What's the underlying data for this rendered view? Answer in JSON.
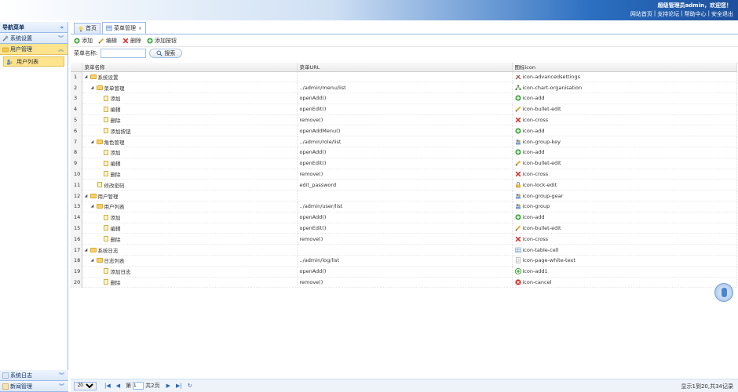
{
  "header": {
    "welcome": "超级管理员admin，欢迎您！",
    "links": [
      "网站首页",
      "支持论坛",
      "帮助中心",
      "安全退出"
    ]
  },
  "sidebar": {
    "title": "导航菜单",
    "items": [
      {
        "label": "系统设置",
        "active": false
      },
      {
        "label": "用户管理",
        "active": true
      }
    ],
    "subitem": "用户列表",
    "bottom": [
      {
        "label": "系统日志"
      },
      {
        "label": "新闻管理"
      }
    ]
  },
  "tabs": [
    {
      "label": "首页",
      "closable": false
    },
    {
      "label": "菜单管理",
      "closable": true
    }
  ],
  "toolbar": {
    "add": "添加",
    "edit": "编辑",
    "delete": "删除",
    "add_button": "添加按钮"
  },
  "search": {
    "label": "菜单名称:",
    "button": "搜索",
    "value": ""
  },
  "grid": {
    "columns": [
      "菜单名称",
      "菜单URL",
      "图标icon"
    ],
    "rows": [
      {
        "n": "1",
        "level": 0,
        "type": "folder",
        "arrow": "◢",
        "name": "系统设置",
        "url": "",
        "icon": "icon-advancedsettings",
        "ic": "advanced"
      },
      {
        "n": "2",
        "level": 1,
        "type": "folder",
        "arrow": "◢",
        "name": "菜单管理",
        "url": "../admin/menu/list",
        "icon": "icon-chart-organisation",
        "ic": "org"
      },
      {
        "n": "3",
        "level": 2,
        "type": "file",
        "arrow": "",
        "name": "添加",
        "url": "openAdd()",
        "icon": "icon-add",
        "ic": "add"
      },
      {
        "n": "4",
        "level": 2,
        "type": "file",
        "arrow": "",
        "name": "编辑",
        "url": "openEdit()",
        "icon": "icon-bullet-edit",
        "ic": "edit"
      },
      {
        "n": "5",
        "level": 2,
        "type": "file",
        "arrow": "",
        "name": "删除",
        "url": "remove()",
        "icon": "icon-cross",
        "ic": "cross"
      },
      {
        "n": "6",
        "level": 2,
        "type": "file",
        "arrow": "",
        "name": "添加按钮",
        "url": "openAddMenu()",
        "icon": "icon-add",
        "ic": "add"
      },
      {
        "n": "7",
        "level": 1,
        "type": "folder",
        "arrow": "◢",
        "name": "角色管理",
        "url": "../admin/role/list",
        "icon": "icon-group-key",
        "ic": "group"
      },
      {
        "n": "8",
        "level": 2,
        "type": "file",
        "arrow": "",
        "name": "添加",
        "url": "openAdd()",
        "icon": "icon-add",
        "ic": "add"
      },
      {
        "n": "9",
        "level": 2,
        "type": "file",
        "arrow": "",
        "name": "编辑",
        "url": "openEdit()",
        "icon": "icon-bullet-edit",
        "ic": "edit"
      },
      {
        "n": "10",
        "level": 2,
        "type": "file",
        "arrow": "",
        "name": "删除",
        "url": "remove()",
        "icon": "icon-cross",
        "ic": "cross"
      },
      {
        "n": "11",
        "level": 1,
        "type": "file",
        "arrow": "",
        "name": "修改密码",
        "url": "edit_password",
        "icon": "icon-lock-edit",
        "ic": "lock"
      },
      {
        "n": "12",
        "level": 0,
        "type": "folder",
        "arrow": "◢",
        "name": "用户管理",
        "url": "",
        "icon": "icon-group-gear",
        "ic": "group"
      },
      {
        "n": "13",
        "level": 1,
        "type": "folder",
        "arrow": "◢",
        "name": "用户列表",
        "url": "../admin/user/list",
        "icon": "icon-group",
        "ic": "group"
      },
      {
        "n": "14",
        "level": 2,
        "type": "file",
        "arrow": "",
        "name": "添加",
        "url": "openAdd()",
        "icon": "icon-add",
        "ic": "add"
      },
      {
        "n": "15",
        "level": 2,
        "type": "file",
        "arrow": "",
        "name": "编辑",
        "url": "openEdit()",
        "icon": "icon-bullet-edit",
        "ic": "edit"
      },
      {
        "n": "16",
        "level": 2,
        "type": "file",
        "arrow": "",
        "name": "删除",
        "url": "remove()",
        "icon": "icon-cross",
        "ic": "cross"
      },
      {
        "n": "17",
        "level": 0,
        "type": "folder",
        "arrow": "◢",
        "name": "系统日志",
        "url": "",
        "icon": "icon-table-cell",
        "ic": "table"
      },
      {
        "n": "18",
        "level": 1,
        "type": "folder",
        "arrow": "◢",
        "name": "日志列表",
        "url": "../admin/log/list",
        "icon": "icon-page-white-text",
        "ic": "page"
      },
      {
        "n": "19",
        "level": 2,
        "type": "file",
        "arrow": "",
        "name": "添加日志",
        "url": "openAdd()",
        "icon": "icon-add1",
        "ic": "add1"
      },
      {
        "n": "20",
        "level": 2,
        "type": "file",
        "arrow": "",
        "name": "删除",
        "url": "remove()",
        "icon": "icon-cancel",
        "ic": "cancel"
      }
    ]
  },
  "pager": {
    "page_size": "20",
    "page_label": "第",
    "page": "1",
    "total_pages": "共2页",
    "info": "显示1到20,共34记录"
  },
  "colors": {
    "accent": "#2c6fc1",
    "active": "#ffe48d"
  }
}
